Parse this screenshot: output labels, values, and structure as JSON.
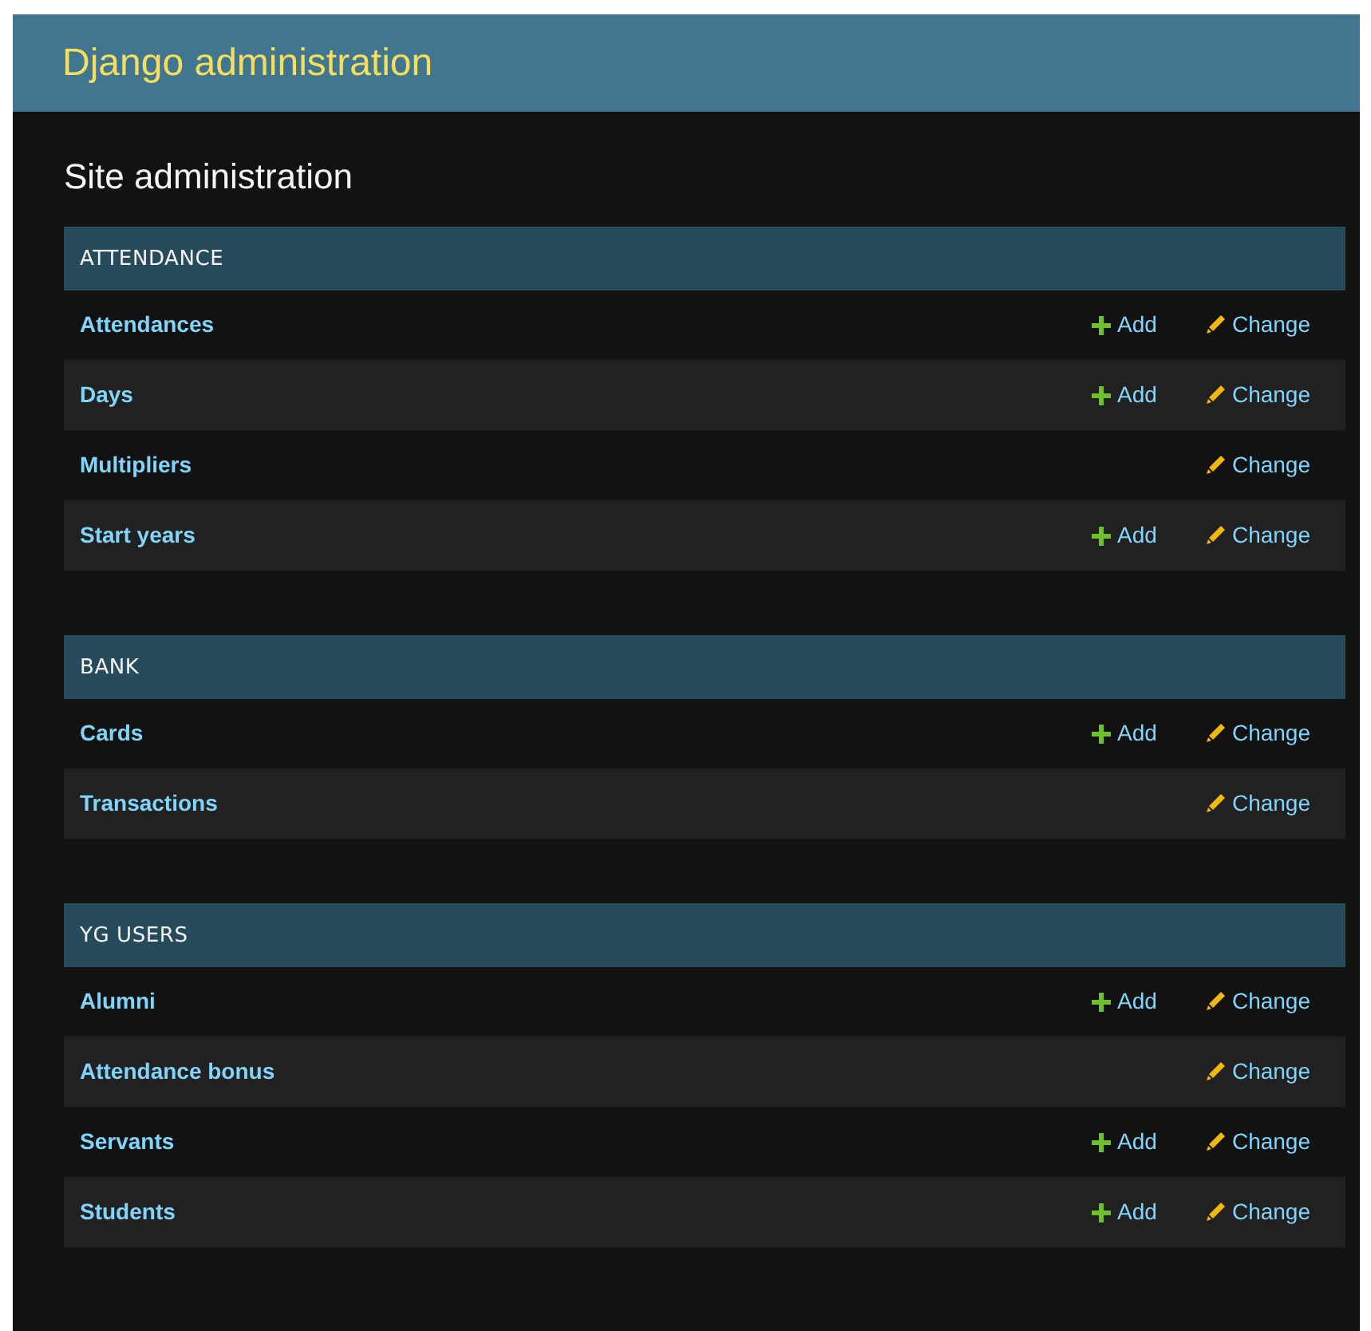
{
  "header": {
    "title": "Django administration"
  },
  "page_title": "Site administration",
  "modules": [
    {
      "caption": "ATTENDANCE",
      "rows": [
        {
          "name": "Attendances",
          "add": "Add",
          "change": "Change"
        },
        {
          "name": "Days",
          "add": "Add",
          "change": "Change"
        },
        {
          "name": "Multipliers",
          "change": "Change"
        },
        {
          "name": "Start years",
          "add": "Add",
          "change": "Change"
        }
      ]
    },
    {
      "caption": "BANK",
      "rows": [
        {
          "name": "Cards",
          "add": "Add",
          "change": "Change"
        },
        {
          "name": "Transactions",
          "change": "Change"
        }
      ]
    },
    {
      "caption": "YG USERS",
      "rows": [
        {
          "name": "Alumni",
          "add": "Add",
          "change": "Change"
        },
        {
          "name": "Attendance bonus",
          "change": "Change"
        },
        {
          "name": "Servants",
          "add": "Add",
          "change": "Change"
        },
        {
          "name": "Students",
          "add": "Add",
          "change": "Change"
        }
      ]
    }
  ]
}
